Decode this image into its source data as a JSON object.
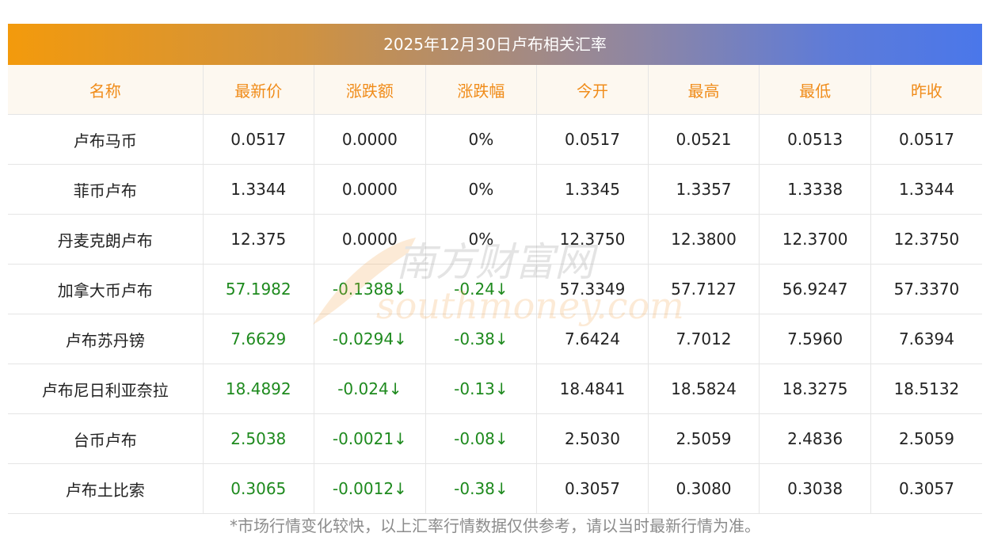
{
  "title": "2025年12月30日卢布相关汇率",
  "headers": [
    "名称",
    "最新价",
    "涨跌额",
    "涨跌幅",
    "今开",
    "最高",
    "最低",
    "昨收"
  ],
  "rows": [
    {
      "name": "卢布马币",
      "latest": "0.0517",
      "change": "0.0000",
      "pct": "0%",
      "open": "0.0517",
      "high": "0.0521",
      "low": "0.0513",
      "prev": "0.0517",
      "down": false
    },
    {
      "name": "菲币卢布",
      "latest": "1.3344",
      "change": "0.0000",
      "pct": "0%",
      "open": "1.3345",
      "high": "1.3357",
      "low": "1.3338",
      "prev": "1.3344",
      "down": false
    },
    {
      "name": "丹麦克朗卢布",
      "latest": "12.375",
      "change": "0.0000",
      "pct": "0%",
      "open": "12.3750",
      "high": "12.3800",
      "low": "12.3700",
      "prev": "12.3750",
      "down": false
    },
    {
      "name": "加拿大币卢布",
      "latest": "57.1982",
      "change": "-0.1388↓",
      "pct": "-0.24↓",
      "open": "57.3349",
      "high": "57.7127",
      "low": "56.9247",
      "prev": "57.3370",
      "down": true
    },
    {
      "name": "卢布苏丹镑",
      "latest": "7.6629",
      "change": "-0.0294↓",
      "pct": "-0.38↓",
      "open": "7.6424",
      "high": "7.7012",
      "low": "7.5960",
      "prev": "7.6394",
      "down": true
    },
    {
      "name": "卢布尼日利亚奈拉",
      "latest": "18.4892",
      "change": "-0.024↓",
      "pct": "-0.13↓",
      "open": "18.4841",
      "high": "18.5824",
      "low": "18.3275",
      "prev": "18.5132",
      "down": true
    },
    {
      "name": "台币卢布",
      "latest": "2.5038",
      "change": "-0.0021↓",
      "pct": "-0.08↓",
      "open": "2.5030",
      "high": "2.5059",
      "low": "2.4836",
      "prev": "2.5059",
      "down": true
    },
    {
      "name": "卢布土比索",
      "latest": "0.3065",
      "change": "-0.0012↓",
      "pct": "-0.38↓",
      "open": "0.3057",
      "high": "0.3080",
      "low": "0.3038",
      "prev": "0.3057",
      "down": true
    }
  ],
  "watermark": {
    "cn": "南方财富网",
    "en": "southmoney.com"
  },
  "footer": "*市场行情变化较快，以上汇率行情数据仅供参考，请以当时最新行情为准。",
  "colors": {
    "header_text": "#f08c1a",
    "down": "#1e8a1e",
    "gradient_start": "#f39a0c",
    "gradient_end": "#4a77ea"
  }
}
